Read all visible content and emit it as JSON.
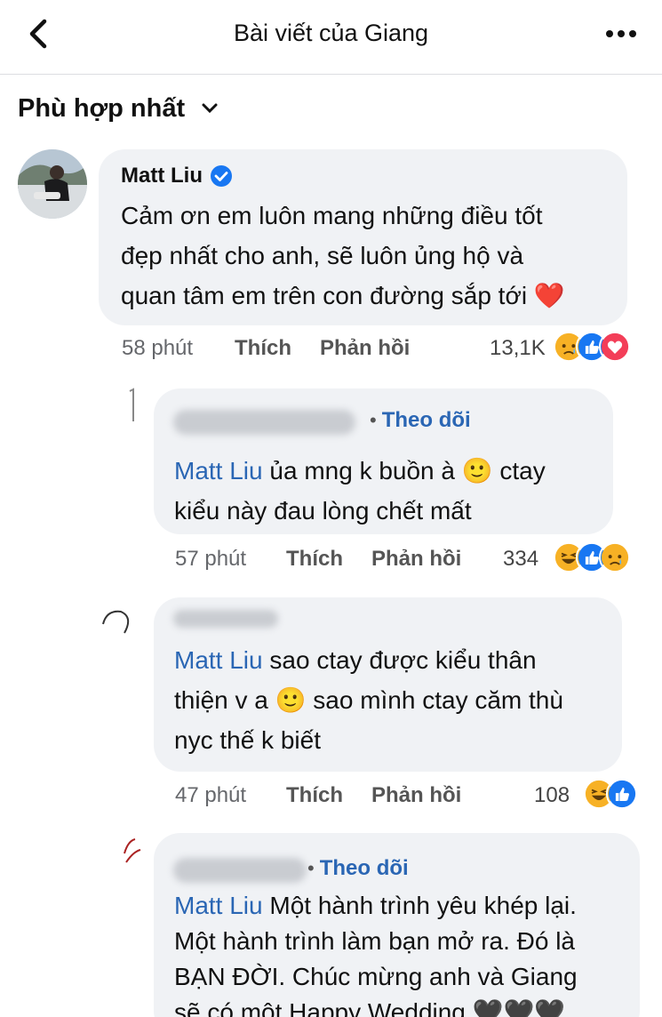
{
  "header": {
    "title": "Bài viết của Giang"
  },
  "sort": {
    "label": "Phù hợp nhất"
  },
  "comments": [
    {
      "author": "Matt Liu",
      "text_lines": [
        "Cảm ơn em luôn mang những điều tốt",
        "đẹp nhất cho anh, sẽ luôn ủng hộ và",
        "quan tâm em trên con đường sắp tới ❤️"
      ],
      "time": "58 phút",
      "like": "Thích",
      "reply": "Phản hồi",
      "reaction_count": "13,1K",
      "reactions": [
        "sad-icon",
        "like-icon",
        "love-icon"
      ]
    }
  ],
  "replies": [
    {
      "follow": "Theo dõi",
      "mention": "Matt Liu",
      "line1": "ủa mng k buồn à 🙂 ctay",
      "line2": "kiểu này đau lòng chết mất",
      "time": "57 phút",
      "like": "Thích",
      "reply": "Phản hồi",
      "reaction_count": "334",
      "reactions": [
        "haha-icon",
        "like-icon",
        "sad-icon"
      ]
    },
    {
      "mention": "Matt Liu",
      "line1": "sao ctay được kiểu thân",
      "line2": "thiện v a 🙂 sao mình ctay căm thù",
      "line3": "nyc thế k biết",
      "time": "47 phút",
      "like": "Thích",
      "reply": "Phản hồi",
      "reaction_count": "108",
      "reactions": [
        "haha-icon",
        "like-icon"
      ]
    },
    {
      "follow": "Theo dõi",
      "mention": "Matt Liu",
      "line1": "Một hành trình yêu khép lại.",
      "line2": "Một hành trình làm bạn mở ra. Đó là",
      "line3": "BẠN ĐỜI. Chúc mừng anh và Giang",
      "line4": "sẽ có một Happy Wedding 🖤🖤🖤"
    }
  ],
  "colors": {
    "link": "#2a66b4",
    "bubble": "#f0f2f5",
    "like": "#1877f2",
    "love": "#f33e58",
    "emoji": "#f7b125"
  }
}
